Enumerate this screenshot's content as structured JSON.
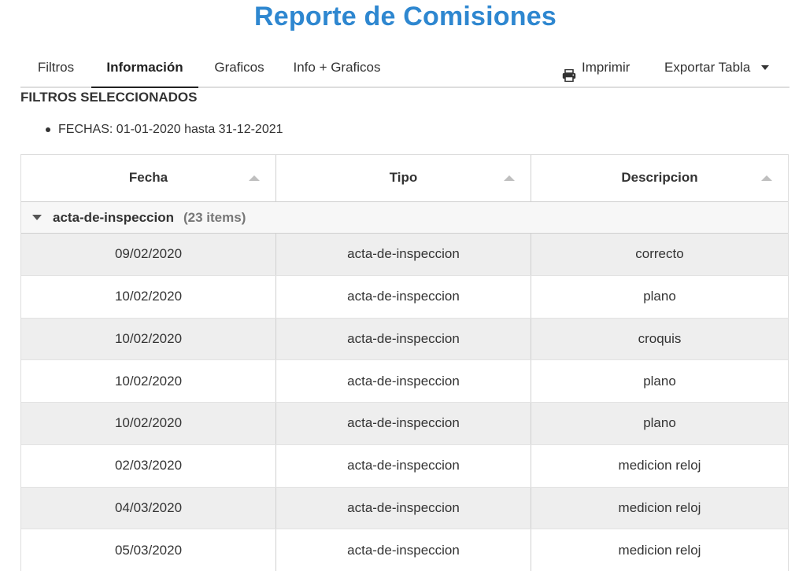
{
  "header": {
    "title": "Reporte de Comisiones"
  },
  "tabs": [
    {
      "label": "Filtros"
    },
    {
      "label": "Información"
    },
    {
      "label": "Graficos"
    },
    {
      "label": "Info + Graficos"
    }
  ],
  "toolbar": {
    "print_label": "Imprimir",
    "export_label": "Exportar Tabla"
  },
  "filters": {
    "heading": "FILTROS SELECCIONADOS",
    "items": [
      "FECHAS: 01-01-2020 hasta 31-12-2021"
    ]
  },
  "table": {
    "columns": [
      "Fecha",
      "Tipo",
      "Descripcion"
    ],
    "group": {
      "name": "acta-de-inspeccion",
      "count": "(23 items)"
    },
    "rows": [
      [
        "09/02/2020",
        "acta-de-inspeccion",
        "correcto"
      ],
      [
        "10/02/2020",
        "acta-de-inspeccion",
        "plano"
      ],
      [
        "10/02/2020",
        "acta-de-inspeccion",
        "croquis"
      ],
      [
        "10/02/2020",
        "acta-de-inspeccion",
        "plano"
      ],
      [
        "10/02/2020",
        "acta-de-inspeccion",
        "plano"
      ],
      [
        "02/03/2020",
        "acta-de-inspeccion",
        "medicion reloj"
      ],
      [
        "04/03/2020",
        "acta-de-inspeccion",
        "medicion reloj"
      ],
      [
        "05/03/2020",
        "acta-de-inspeccion",
        "medicion reloj"
      ]
    ]
  },
  "icons": {
    "print": "printer-icon",
    "export_caret": "caret-down-icon",
    "sort": "sort-arrow-up-icon",
    "group_toggle": "triangle-down-icon"
  },
  "colors": {
    "title": "#2e87d0",
    "row_alt": "#eeeeee",
    "group_bg": "#f7f7f7"
  }
}
